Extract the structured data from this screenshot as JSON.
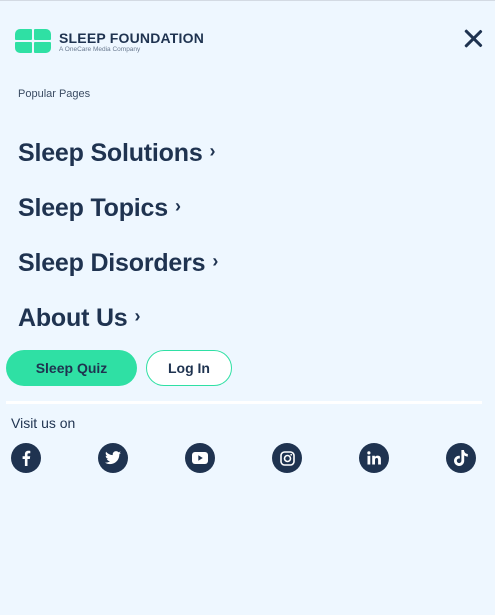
{
  "header": {
    "brand_name": "SLEEP FOUNDATION",
    "brand_tagline": "A OneCare Media Company",
    "close_icon": "close-icon"
  },
  "menu": {
    "section_label": "Popular Pages",
    "items": [
      {
        "label": "Sleep Solutions",
        "icon": "chevron-right-icon"
      },
      {
        "label": "Sleep Topics",
        "icon": "chevron-right-icon"
      },
      {
        "label": "Sleep Disorders",
        "icon": "chevron-right-icon"
      },
      {
        "label": "About Us",
        "icon": "chevron-right-icon"
      }
    ]
  },
  "actions": {
    "quiz_label": "Sleep Quiz",
    "login_label": "Log In"
  },
  "social": {
    "label": "Visit us on",
    "icons": [
      "facebook-icon",
      "twitter-icon",
      "youtube-icon",
      "instagram-icon",
      "linkedin-icon",
      "tiktok-icon"
    ]
  },
  "colors": {
    "background": "#eef7ff",
    "accent": "#2fe0a4",
    "text": "#1f3350"
  }
}
